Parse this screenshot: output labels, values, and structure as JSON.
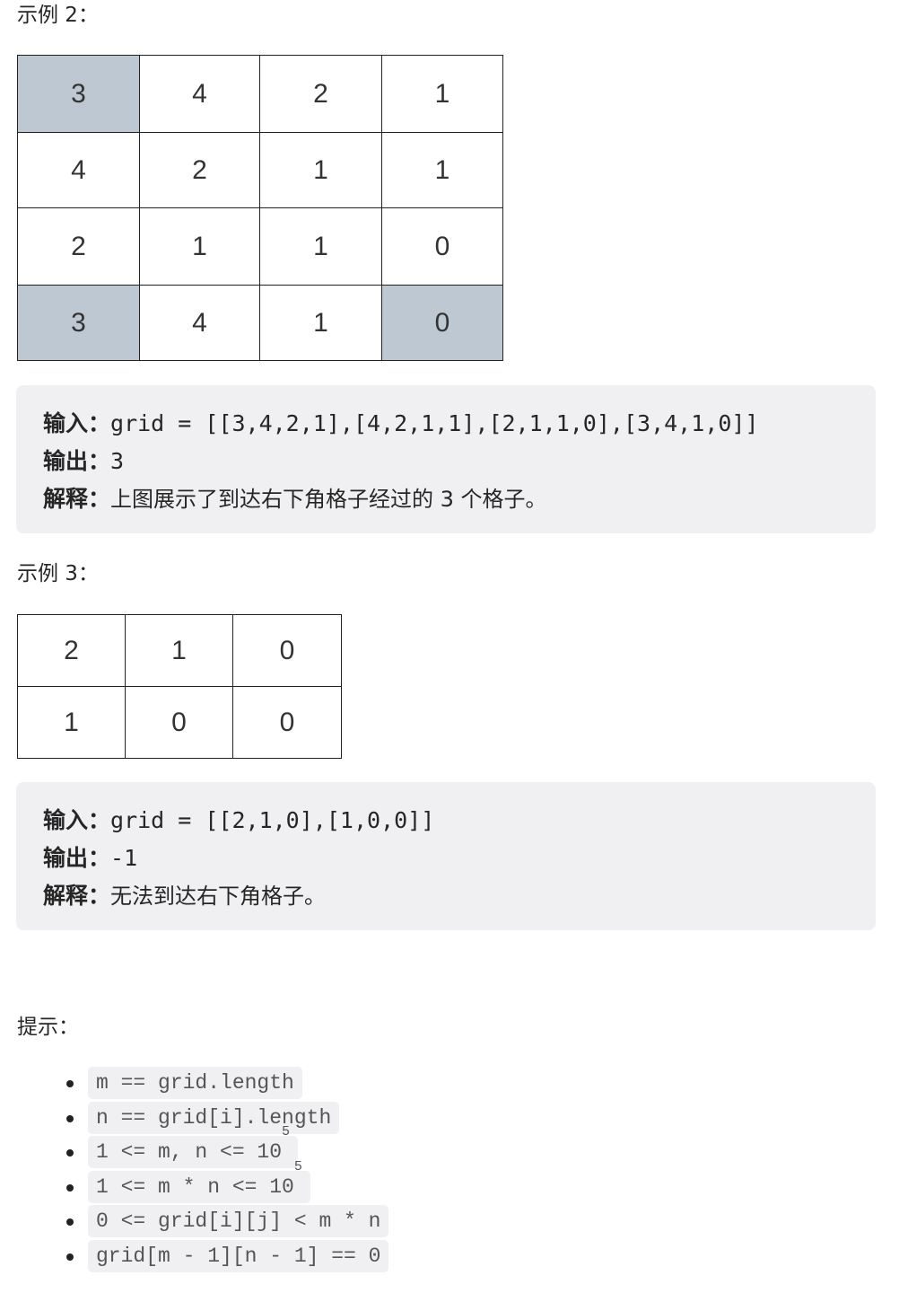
{
  "example2": {
    "heading": "示例 2：",
    "grid": [
      [
        "3",
        "4",
        "2",
        "1"
      ],
      [
        "4",
        "2",
        "1",
        "1"
      ],
      [
        "2",
        "1",
        "1",
        "0"
      ],
      [
        "3",
        "4",
        "1",
        "0"
      ]
    ],
    "highlighted": [
      [
        0,
        0
      ],
      [
        3,
        0
      ],
      [
        3,
        3
      ]
    ],
    "highlight_color": "#bec8d2",
    "input_label": "输入：",
    "input_value": "grid = [[3,4,2,1],[4,2,1,1],[2,1,1,0],[3,4,1,0]]",
    "output_label": "输出：",
    "output_value": "3",
    "explain_label": "解释：",
    "explain_value": "上图展示了到达右下角格子经过的 3 个格子。"
  },
  "example3": {
    "heading": "示例 3：",
    "grid": [
      [
        "2",
        "1",
        "0"
      ],
      [
        "1",
        "0",
        "0"
      ]
    ],
    "input_label": "输入：",
    "input_value": "grid = [[2,1,0],[1,0,0]]",
    "output_label": "输出：",
    "output_value": "-1",
    "explain_label": "解释：",
    "explain_value": "无法到达右下角格子。"
  },
  "hints": {
    "heading": "提示：",
    "items": [
      {
        "text": "m == grid.length",
        "sup": ""
      },
      {
        "text": "n == grid[i].length",
        "sup": ""
      },
      {
        "text": "1 <= m, n <= 10",
        "sup": "5"
      },
      {
        "text": "1 <= m * n <= 10",
        "sup": "5"
      },
      {
        "text": "0 <= grid[i][j] < m * n",
        "sup": ""
      },
      {
        "text": "grid[m - 1][n - 1] == 0",
        "sup": ""
      }
    ]
  }
}
